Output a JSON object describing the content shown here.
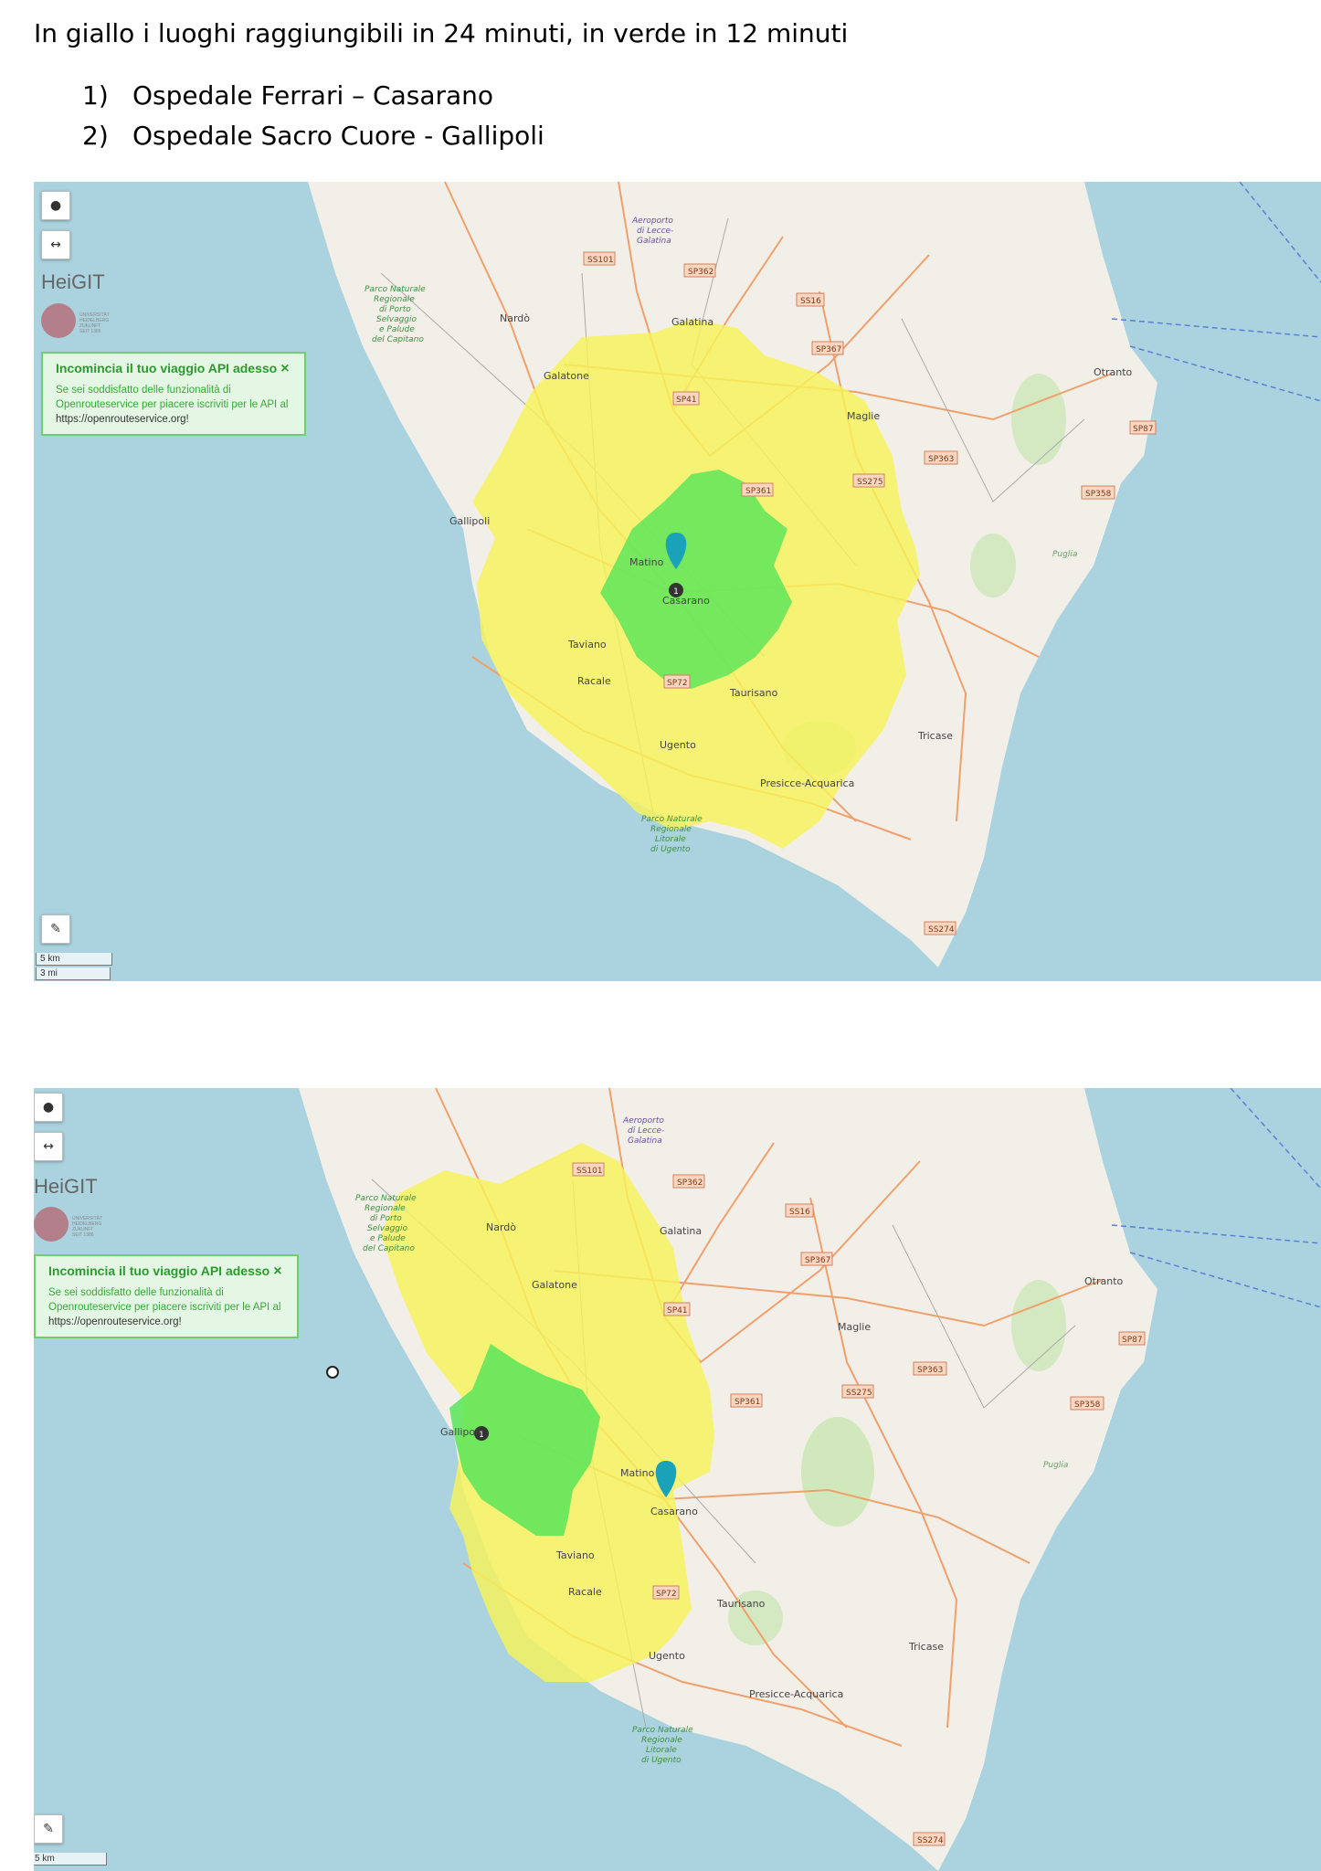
{
  "heading": "In giallo i luoghi raggiungibili in 24 minuti, in verde in 12 minuti",
  "hospitals": [
    {
      "num": "1)",
      "name": "Ospedale Ferrari – Casarano"
    },
    {
      "num": "2)",
      "name": "Ospedale Sacro Cuore - Gallipoli"
    }
  ],
  "colors": {
    "sea": "#aad3df",
    "land": "#f2efe9",
    "isochrone_24min": "#f7f35a",
    "isochrone_12min": "#58e558",
    "marker": "#1aa3b8",
    "road": "#f0a06a"
  },
  "map_ui": {
    "logo": "HeiGIT",
    "seal_text": "UNIVERSITÄT HEIDELBERG ZUKUNFT SEIT 1386",
    "location_icon": "map-pin-icon",
    "measure_icon": "arrows-horizontal-icon",
    "draw_icon": "pencil-icon",
    "promo_title": "Incomincia il tuo viaggio API adesso",
    "promo_close": "×",
    "promo_text": "Se sei soddisfatto delle funzionalità di Openrouteservice per piacere iscriviti per le API al",
    "promo_url": "https://openrouteservice.org!",
    "scale_km": "5 km",
    "scale_mi": "3 mi"
  },
  "place_labels": {
    "airport": "Aeroporto",
    "airport2": "di Lecce-",
    "airport3": "Galatina",
    "nardo": "Nardò",
    "galatina": "Galatina",
    "galatone": "Galatone",
    "otranto": "Otranto",
    "maglie": "Maglie",
    "gallipoli": "Gallipoli",
    "matino": "Matino",
    "casarano": "Casarano",
    "taviano": "Taviano",
    "racale": "Racale",
    "taurisano": "Taurisano",
    "ugento": "Ugento",
    "tricase": "Tricase",
    "presicce": "Presicce-Acquarica",
    "parco1_a": "Parco Naturale",
    "parco1_b": "Regionale",
    "parco1_c": "di Porto",
    "parco1_d": "Selvaggio",
    "parco1_e": "e Palude",
    "parco1_f": "del Capitano",
    "parco2_a": "Parco Naturale",
    "parco2_b": "Regionale",
    "parco2_c": "Litorale",
    "parco2_d": "di Ugento",
    "puglia": "Puglia",
    "marker_num": "1"
  },
  "road_labels": {
    "ss101": "SS101",
    "sp362": "SP362",
    "ss16": "SS16",
    "sp367": "SP367",
    "sp41": "SP41",
    "sp87": "SP87",
    "sp363": "SP363",
    "sp361": "SP361",
    "ss275": "SS275",
    "sp358": "SP358",
    "sp72": "SP72",
    "ss274": "SS274"
  }
}
